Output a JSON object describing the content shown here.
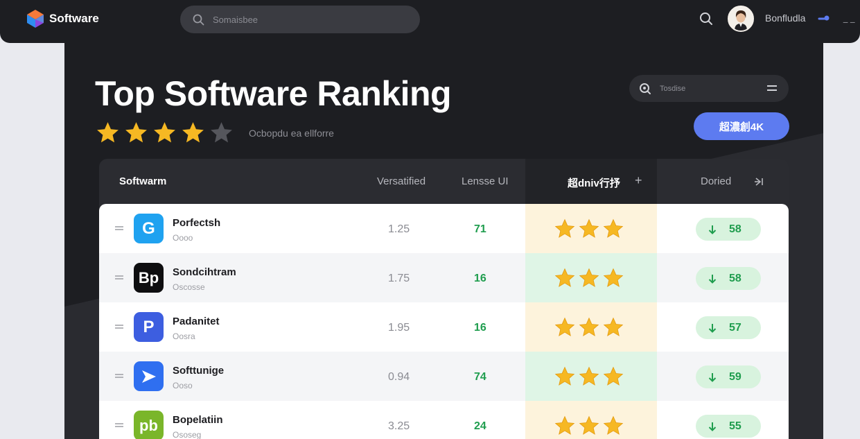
{
  "app": {
    "title": "Software"
  },
  "search": {
    "placeholder": "Somaisbee"
  },
  "user": {
    "name": "Bonfludla"
  },
  "hero": {
    "title": "Top Software Ranking",
    "subtitle": "Ocbopdu ea ellforre",
    "rating": 4,
    "max_rating": 5
  },
  "filter": {
    "label": "Tosdise"
  },
  "cta": {
    "label": "超濃創4K"
  },
  "table": {
    "headers": {
      "software": "Softwarm",
      "version": "Versatified",
      "license": "Lensse UI",
      "rating": "超dniv行抒",
      "downloads": "Doried"
    },
    "rows": [
      {
        "name": "Porfectsh",
        "sub": "Oooo",
        "version": "1.25",
        "score": "71",
        "stars": 3,
        "downloads": "58",
        "icon": "blue-g-app-icon",
        "icon_text": "G",
        "icon_color": "#1fa2f0",
        "rating_bg": "#fdf3dc"
      },
      {
        "name": "Sondcihtram",
        "sub": "Oscosse",
        "version": "1.75",
        "score": "16",
        "stars": 3,
        "downloads": "58",
        "icon": "bp-app-icon",
        "icon_text": "Bp",
        "icon_color": "#0e0e10",
        "rating_bg": "#dff5e6"
      },
      {
        "name": "Padanitet",
        "sub": "Oosra",
        "version": "1.95",
        "score": "16",
        "stars": 3,
        "downloads": "57",
        "icon": "p-app-icon",
        "icon_text": "P",
        "icon_color": "#3d5ee0",
        "rating_bg": "#fdf3dc"
      },
      {
        "name": "Softtunige",
        "sub": "Ooso",
        "version": "0.94",
        "score": "74",
        "stars": 3,
        "downloads": "59",
        "icon": "play-app-icon",
        "icon_text": "",
        "icon_color": "#2f6ff0",
        "rating_bg": "#dff5e6"
      },
      {
        "name": "Bopelatiin",
        "sub": "Ososeg",
        "version": "3.25",
        "score": "24",
        "stars": 3,
        "downloads": "55",
        "icon": "pb-app-icon",
        "icon_text": "pb",
        "icon_color": "#7ab62a",
        "rating_bg": "#fdf3dc"
      }
    ]
  },
  "colors": {
    "accent": "#5d7bf0",
    "success": "#1f9d4e",
    "star": "#f6b823",
    "panel": "#1d1e22"
  }
}
